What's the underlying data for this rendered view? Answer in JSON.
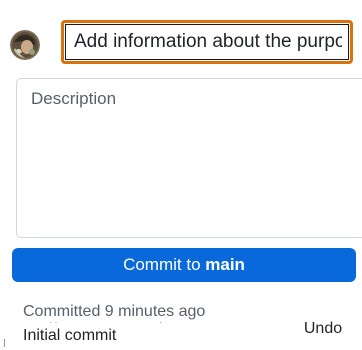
{
  "commit_panel": {
    "summary": {
      "placeholder": "Add information about the purpose",
      "value": ""
    },
    "description": {
      "placeholder": "Description",
      "value": ""
    },
    "commit_button": {
      "prefix": "Commit to ",
      "branch": "main"
    }
  },
  "recent_commit": {
    "status": "Committed 9 minutes ago",
    "message": "Initial commit",
    "undo_label": "Undo"
  },
  "colors": {
    "focus_ring": "#d9720d",
    "primary_button": "#0969da",
    "muted_text": "#57606a"
  },
  "icons": {
    "avatar": "user-avatar"
  }
}
